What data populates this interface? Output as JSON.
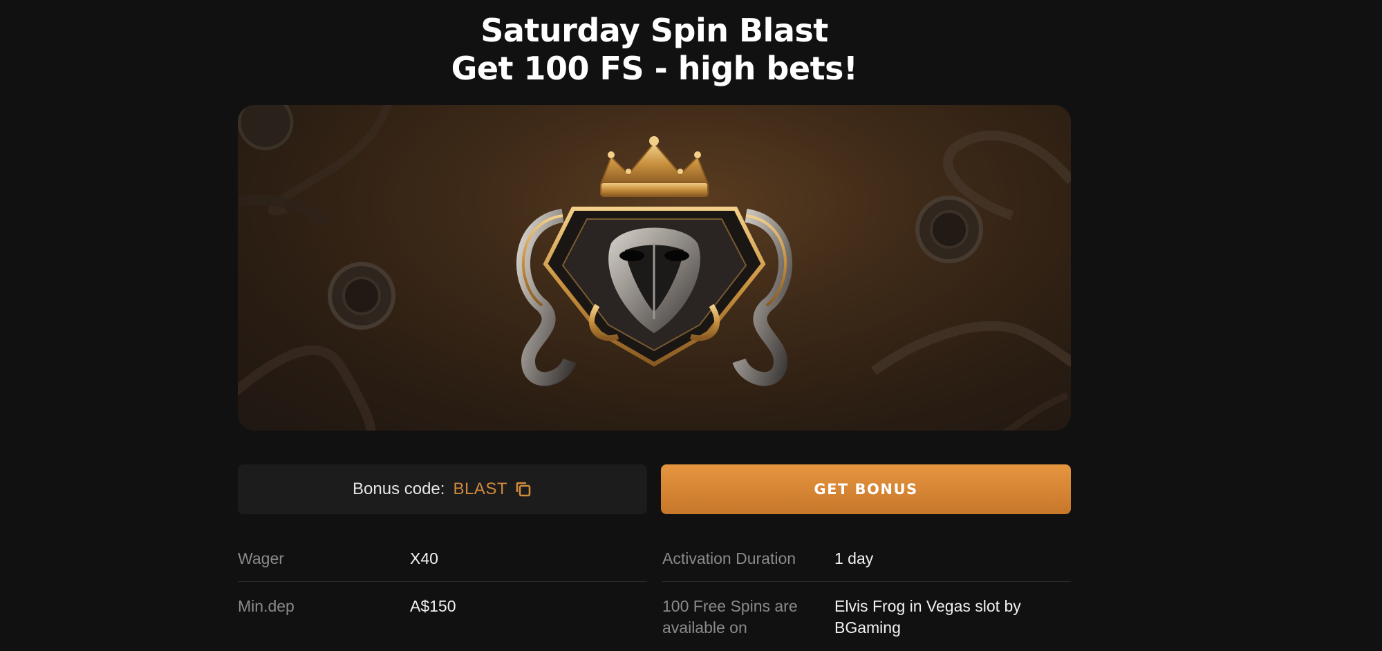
{
  "promo": {
    "title_line1": "Saturday Spin Blast",
    "title_line2": "Get 100 FS - high bets!"
  },
  "bonus": {
    "code_label": "Bonus code:",
    "code_value": "BLAST",
    "button_label": "GET BONUS"
  },
  "details": {
    "wager_label": "Wager",
    "wager_value": "X40",
    "mindep_label": "Min.dep",
    "mindep_value": "A$150",
    "activation_label": "Activation Duration",
    "activation_value": "1 day",
    "spins_label_line1": "100 Free Spins are",
    "spins_label_line2": "available on",
    "spins_value_line1": "Elvis Frog in Vegas slot by",
    "spins_value_line2": "BGaming"
  },
  "colors": {
    "background": "#121111",
    "accent": "#d08a3e",
    "button": "#e08d3a"
  },
  "icons": {
    "copy": "copy-icon",
    "banner": "crowned-snake-emblem"
  }
}
